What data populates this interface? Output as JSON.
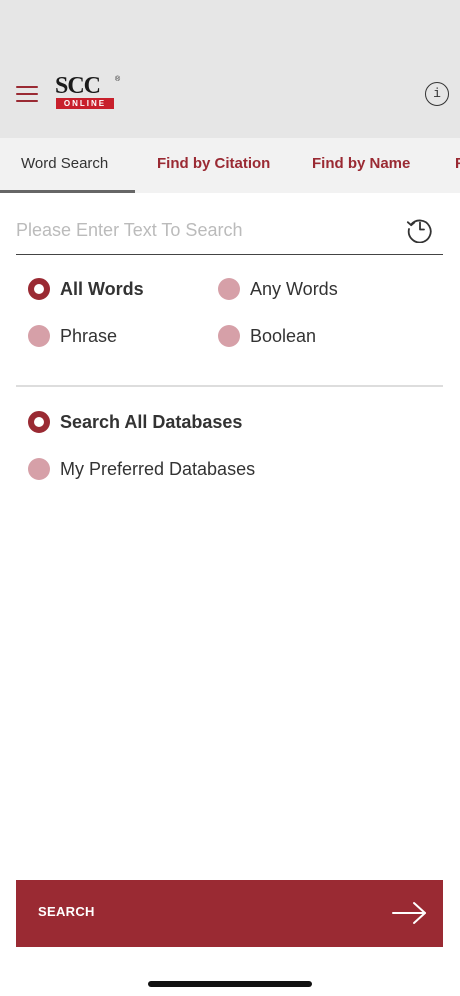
{
  "header": {
    "logo": {
      "main": "SCC",
      "band": "ONLINE",
      "registered": "®"
    },
    "info_icon_glyph": "i"
  },
  "tabs": [
    {
      "label": "Word Search",
      "active": true
    },
    {
      "label": "Find by Citation",
      "active": false
    },
    {
      "label": "Find by Name",
      "active": false
    },
    {
      "label": "F",
      "active": false
    }
  ],
  "search": {
    "placeholder": "Please Enter Text To Search",
    "value": ""
  },
  "match_options": [
    {
      "label": "All Words",
      "selected": true
    },
    {
      "label": "Any Words",
      "selected": false
    },
    {
      "label": "Phrase",
      "selected": false
    },
    {
      "label": "Boolean",
      "selected": false
    }
  ],
  "database_options": [
    {
      "label": "Search All Databases",
      "selected": true
    },
    {
      "label": "My Preferred Databases",
      "selected": false
    }
  ],
  "search_button": {
    "label": "SEARCH"
  },
  "colors": {
    "accent": "#9a2a33",
    "unselected_radio": "#d6a0a8",
    "header_bg": "#e6e6e6"
  },
  "icons": [
    "menu-icon",
    "info-icon",
    "history-icon",
    "arrow-right-icon"
  ]
}
